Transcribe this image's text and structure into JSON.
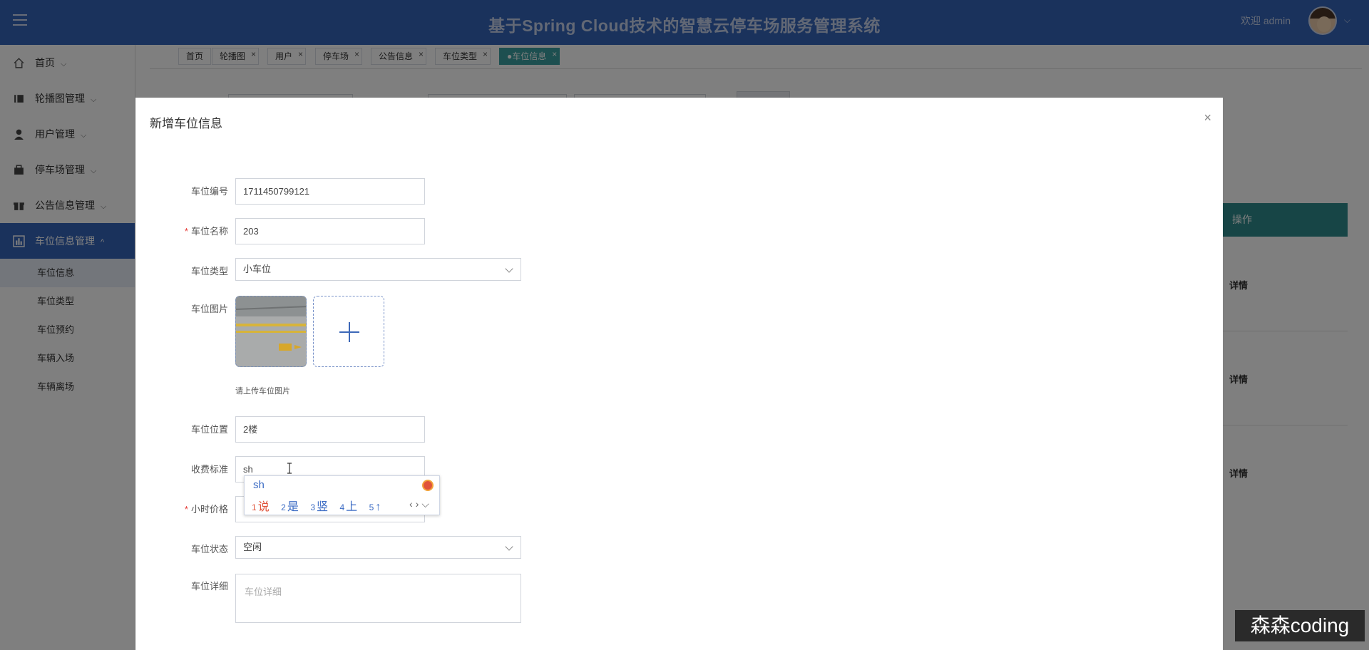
{
  "header": {
    "title": "基于Spring Cloud技术的智慧云停车场服务管理系统",
    "welcome": "欢迎 admin"
  },
  "sidebar": {
    "items": [
      {
        "label": "首页",
        "icon": "home-icon"
      },
      {
        "label": "轮播图管理",
        "icon": "image-icon"
      },
      {
        "label": "用户管理",
        "icon": "user-icon"
      },
      {
        "label": "停车场管理",
        "icon": "parking-icon"
      },
      {
        "label": "公告信息管理",
        "icon": "gift-icon"
      },
      {
        "label": "车位信息管理",
        "icon": "bar-chart-icon"
      }
    ],
    "submenu": [
      "车位信息",
      "车位类型",
      "车位预约",
      "车辆入场",
      "车辆离场"
    ]
  },
  "tabs": [
    "首页",
    "轮播图",
    "用户",
    "停车场",
    "公告信息",
    "车位类型",
    "●车位信息"
  ],
  "background_table": {
    "header": "操作",
    "row_action": "详情"
  },
  "modal": {
    "title": "新增车位信息",
    "close": "×",
    "fields": {
      "code": {
        "label": "车位编号",
        "value": "1711450799121"
      },
      "name": {
        "label": "车位名称",
        "value": "203",
        "required": true
      },
      "type": {
        "label": "车位类型",
        "value": "小车位"
      },
      "image": {
        "label": "车位图片",
        "hint": "请上传车位图片"
      },
      "location": {
        "label": "车位位置",
        "value": "2楼"
      },
      "fee": {
        "label": "收费标准",
        "value": "sh"
      },
      "hourly": {
        "label": "小时价格",
        "required": true
      },
      "status": {
        "label": "车位状态",
        "value": "空闲"
      },
      "detail": {
        "label": "车位详细",
        "placeholder": "车位详细"
      }
    }
  },
  "ime": {
    "composition": "sh",
    "candidates": [
      {
        "n": "1",
        "text": "说"
      },
      {
        "n": "2",
        "text": "是"
      },
      {
        "n": "3",
        "text": "竖"
      },
      {
        "n": "4",
        "text": "上"
      },
      {
        "n": "5",
        "text": "↑"
      }
    ]
  },
  "watermark": "森森coding",
  "colors": {
    "header": "#3565b8",
    "active_tab": "#3a9fa0",
    "table_header": "#2f8b8c",
    "required": "#e53935"
  }
}
